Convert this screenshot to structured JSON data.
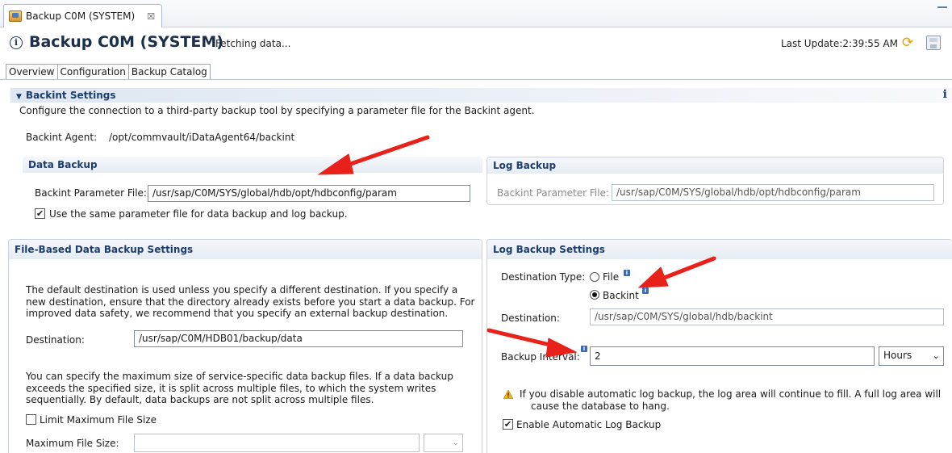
{
  "editor_tab": {
    "label": "Backup C0M (SYSTEM)",
    "close": "☒"
  },
  "header": {
    "title": "Backup C0M (SYSTEM)",
    "status": "Fetching data...",
    "last_update": "Last Update:2:39:55 AM"
  },
  "tabs": [
    {
      "label": "Overview"
    },
    {
      "label": "Configuration"
    },
    {
      "label": "Backup Catalog"
    }
  ],
  "backint": {
    "section_title": "Backint Settings",
    "description": "Configure the connection to a third-party backup tool by specifying a parameter file for the Backint agent.",
    "agent_label": "Backint Agent:",
    "agent_value": "/opt/commvault/iDataAgent64/backint",
    "data_backup": {
      "title": "Data Backup",
      "param_label": "Backint Parameter File:",
      "param_value": "/usr/sap/C0M/SYS/global/hdb/opt/hdbconfig/param",
      "same_file_label": "Use the same parameter file for data backup and log backup."
    },
    "log_backup": {
      "title": "Log Backup",
      "param_label": "Backint Parameter File:",
      "param_value": "/usr/sap/C0M/SYS/global/hdb/opt/hdbconfig/param"
    }
  },
  "file_based": {
    "title": "File-Based Data Backup Settings",
    "desc_lines": [
      "The default destination is used unless you specify a different destination. If you specify a",
      "new destination, ensure that the directory already exists before you start a data backup. For",
      "improved data safety, we recommend that you specify an external backup destination."
    ],
    "destination_label": "Destination:",
    "destination_value": "/usr/sap/C0M/HDB01/backup/data",
    "size_lines": [
      "You can specify the maximum size of service-specific data backup files. If a data backup",
      "exceeds the specified size, it is split across multiple files, to which the system writes",
      "sequentially. By default, data backups are not split across multiple files."
    ],
    "limit_label": "Limit Maximum File Size",
    "max_size_label": "Maximum File Size:",
    "max_size_value": ""
  },
  "log_settings": {
    "title": "Log Backup Settings",
    "dest_type_label": "Destination Type:",
    "option_file": "File",
    "option_backint": "Backint",
    "destination_label": "Destination:",
    "destination_value": "/usr/sap/C0M/SYS/global/hdb/backint",
    "interval_label": "Backup Interval:",
    "interval_value": "2",
    "interval_unit": "Hours",
    "warning_lines": [
      "If you disable automatic log backup, the log area will continue to fill. A full log area will",
      "cause the database to hang."
    ],
    "auto_label": "Enable Automatic Log Backup"
  },
  "colors": {
    "accent": "#1c3d6e",
    "arrow": "#e8211a"
  }
}
